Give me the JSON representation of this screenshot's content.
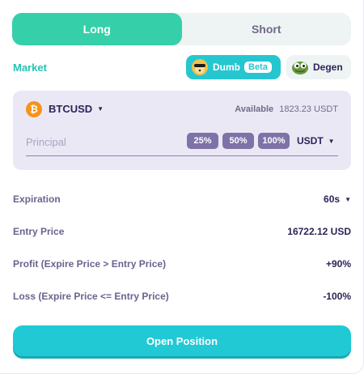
{
  "tabs": {
    "long_label": "Long",
    "short_label": "Short",
    "active": "Long"
  },
  "market": {
    "label": "Market",
    "modes": {
      "dumb_label": "Dumb",
      "dumb_badge": "Beta",
      "degen_label": "Degen"
    }
  },
  "order": {
    "pair": "BTCUSD",
    "coin_glyph": "₿",
    "available_label": "Available",
    "available_value": "1823.23 USDT",
    "principal_placeholder": "Principal",
    "percent_buttons": [
      "25%",
      "50%",
      "100%"
    ],
    "currency": "USDT"
  },
  "details": {
    "expiration_label": "Expiration",
    "expiration_value": "60s",
    "entry_price_label": "Entry Price",
    "entry_price_value": "16722.12 USD",
    "profit_label": "Profit (Expire Price > Entry Price)",
    "profit_value": "+90%",
    "loss_label": "Loss (Expire Price <= Entry Price)",
    "loss_value": "-100%"
  },
  "actions": {
    "open_position_label": "Open Position"
  },
  "colors": {
    "accent_green": "#35d0a9",
    "accent_cyan": "#21c9d4",
    "panel_bg": "#ebe8f5",
    "text_dark": "#2c2457",
    "bitcoin": "#f7931a"
  }
}
